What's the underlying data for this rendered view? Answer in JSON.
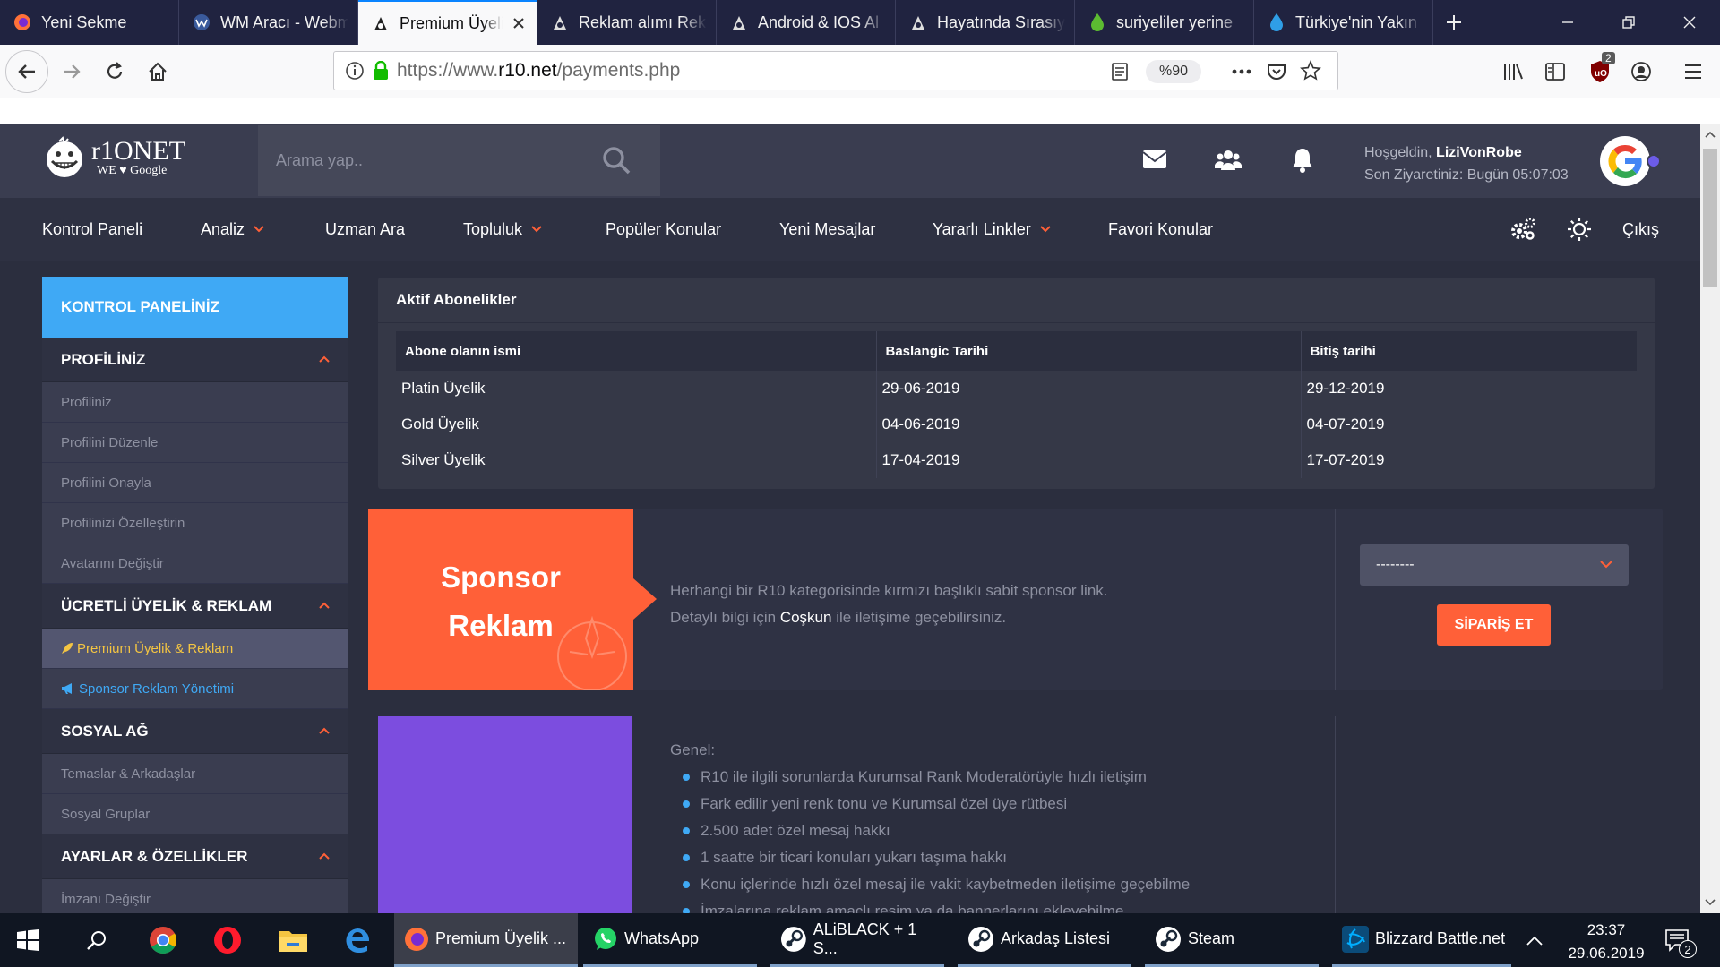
{
  "browser": {
    "tabs": [
      {
        "label": "Yeni Sekme",
        "icon": "firefox-icon"
      },
      {
        "label": "WM Aracı - Webm",
        "icon": "wm-tool-icon"
      },
      {
        "label": "Premium Üyelik",
        "icon": "r10-icon",
        "active": true
      },
      {
        "label": "Reklam alımı Rekl",
        "icon": "r10-icon"
      },
      {
        "label": "Android & IOS Al",
        "icon": "r10-icon"
      },
      {
        "label": "Hayatında Sırasıyl",
        "icon": "r10-icon"
      },
      {
        "label": "suriyeliler yerine",
        "icon": "drop-green-icon"
      },
      {
        "label": "Türkiye'nin Yakın",
        "icon": "drop-blue-icon"
      }
    ],
    "url_prefix": "https://www.",
    "url_domain": "r10.net",
    "url_path": "/payments.php",
    "zoom": "%90",
    "ublock_count": "2"
  },
  "site": {
    "logo_text": "r1ONET",
    "logo_sub": "WE ♥ Google",
    "search_placeholder": "Arama yap..",
    "welcome_prefix": "Hoşgeldin, ",
    "username": "LiziVonRobe",
    "last_visit": "Son Ziyaretiniz: Bugün 05:07:03",
    "nav": [
      {
        "label": "Kontrol Paneli",
        "caret": false
      },
      {
        "label": "Analiz",
        "caret": true
      },
      {
        "label": "Uzman Ara",
        "caret": false
      },
      {
        "label": "Topluluk",
        "caret": true
      },
      {
        "label": "Popüler Konular",
        "caret": false
      },
      {
        "label": "Yeni Mesajlar",
        "caret": false
      },
      {
        "label": "Yararlı Linkler",
        "caret": true
      },
      {
        "label": "Favori Konular",
        "caret": false
      }
    ],
    "logout": "Çıkış"
  },
  "sidebar": {
    "title": "KONTROL PANELİNİZ",
    "sections": [
      {
        "title": "PROFİLİNİZ",
        "items": [
          "Profiliniz",
          "Profilini Düzenle",
          "Profilini Onayla",
          "Profilinizi Özelleştirin",
          "Avatarını Değiştir"
        ]
      },
      {
        "title": "ÜCRETLİ ÜYELİK & REKLAM",
        "items": [
          "Premium Üyelik & Reklam",
          "Sponsor Reklam Yönetimi"
        ]
      },
      {
        "title": "SOSYAL AĞ",
        "items": [
          "Temaslar & Arkadaşlar",
          "Sosyal Gruplar"
        ]
      },
      {
        "title": "AYARLAR & ÖZELLİKLER",
        "items": [
          "İmzanı Değiştir"
        ]
      }
    ]
  },
  "subscriptions": {
    "title": "Aktif Abonelikler",
    "headers": [
      "Abone olanın ismi",
      "Baslangic Tarihi",
      "Bitiş tarihi"
    ],
    "rows": [
      [
        "Platin Üyelik",
        "29-06-2019",
        "29-12-2019"
      ],
      [
        "Gold Üyelik",
        "04-06-2019",
        "04-07-2019"
      ],
      [
        "Silver Üyelik",
        "17-04-2019",
        "17-07-2019"
      ]
    ]
  },
  "sponsor": {
    "title_line1": "Sponsor",
    "title_line2": "Reklam",
    "desc_line1": "Herhangi bir R10 kategorisinde kırmızı başlıklı sabit sponsor link.",
    "desc_line2_prefix": "Detaylı bilgi için ",
    "desc_link": "Coşkun",
    "desc_line2_suffix": " ile iletişime geçebilirsiniz.",
    "select_value": "--------",
    "order_button": "SİPARİŞ ET",
    "color": "#ff6038"
  },
  "corporate": {
    "heading": "Genel:",
    "features": [
      "R10 ile ilgili sorunlarda Kurumsal Rank Moderatörüyle hızlı iletişim",
      "Fark edilir yeni renk tonu ve Kurumsal özel üye rütbesi",
      "2.500 adet özel mesaj hakkı",
      "1 saatte bir ticari konuları yukarı taşıma hakkı",
      "Konu içlerinde hızlı özel mesaj ile vakit kaybetmeden iletişime geçebilme",
      "İmzalarına reklam amaçlı resim ya da bannerlarını ekleyebilme"
    ],
    "color": "#7c4ddf"
  },
  "taskbar": {
    "apps": [
      {
        "label": "Premium Üyelik ...",
        "icon": "firefox-icon"
      },
      {
        "label": "WhatsApp",
        "icon": "whatsapp-icon"
      },
      {
        "label": "ALiBLACK + 1 S...",
        "icon": "steam-icon"
      },
      {
        "label": "Arkadaş Listesi",
        "icon": "steam-icon"
      },
      {
        "label": "Steam",
        "icon": "steam-icon"
      },
      {
        "label": "Blizzard Battle.net",
        "icon": "battlenet-icon"
      }
    ],
    "time": "23:37",
    "date": "29.06.2019",
    "notifications": "2"
  },
  "colors": {
    "accent_blue": "#3fa9f5",
    "accent_orange": "#ff6038",
    "bg_dark": "#2b2e3e",
    "header": "#3a3d50"
  }
}
